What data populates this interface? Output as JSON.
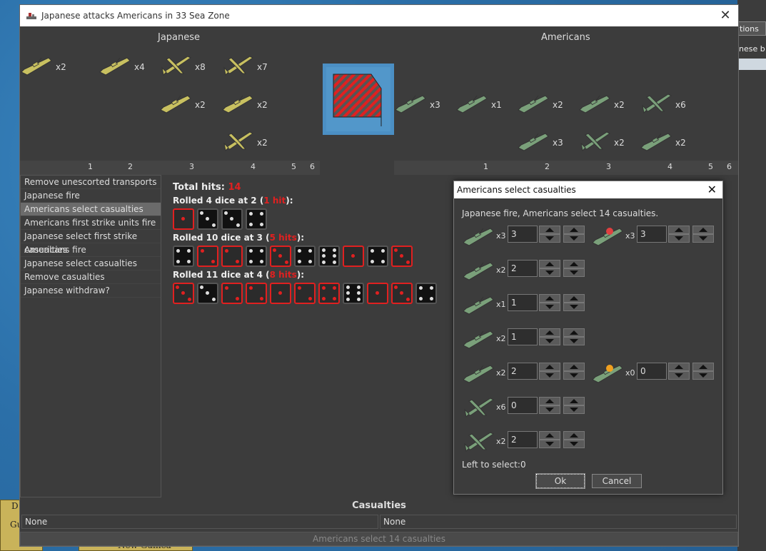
{
  "window": {
    "title": "Japanese attacks Americans in 33 Sea Zone",
    "left_side": "Japanese",
    "right_side": "Americans"
  },
  "background": {
    "tab_label": "tions",
    "text": "nese b",
    "map_label_1": "D",
    "map_label_2": "Gu",
    "map_label_3": "New Guinea"
  },
  "attackers": [
    {
      "count": "x2"
    },
    {
      "count": "x4"
    },
    {
      "count": "x8"
    },
    {
      "count": "x7"
    },
    {
      "count": "x2"
    },
    {
      "count": "x2"
    },
    {
      "count": "x2"
    }
  ],
  "defenders": [
    {
      "count": "x3"
    },
    {
      "count": "x1"
    },
    {
      "count": "x2"
    },
    {
      "count": "x2"
    },
    {
      "count": "x6"
    },
    {
      "count": "x3"
    },
    {
      "count": "x2"
    },
    {
      "count": "x2"
    }
  ],
  "left_ruler": [
    "1",
    "2",
    "3",
    "4",
    "5",
    "6"
  ],
  "right_ruler": [
    "1",
    "2",
    "3",
    "4",
    "5",
    "6"
  ],
  "steps": [
    "Remove unescorted transports",
    "Japanese fire",
    "Americans select casualties",
    "Americans first strike units fire",
    "Japanese select first strike casualties",
    "Americans fire",
    "Japanese select casualties",
    "Remove casualties",
    "Japanese withdraw?"
  ],
  "selected_step": 2,
  "dice": {
    "total_label": "Total hits:",
    "total_value": "14",
    "rolls": [
      {
        "prefix": "Rolled 4 dice at 2 (",
        "hits": "1 hit",
        "suffix": "):",
        "dice": [
          {
            "v": 1,
            "hit": true
          },
          {
            "v": 3,
            "hit": false
          },
          {
            "v": 3,
            "hit": false
          },
          {
            "v": 4,
            "hit": false
          }
        ]
      },
      {
        "prefix": "Rolled 10 dice at 3 (",
        "hits": "5 hits",
        "suffix": "):",
        "dice": [
          {
            "v": 4,
            "hit": false
          },
          {
            "v": 2,
            "hit": true
          },
          {
            "v": 2,
            "hit": true
          },
          {
            "v": 4,
            "hit": false
          },
          {
            "v": 3,
            "hit": true
          },
          {
            "v": 4,
            "hit": false
          },
          {
            "v": 6,
            "hit": false
          },
          {
            "v": 1,
            "hit": true
          },
          {
            "v": 4,
            "hit": false
          },
          {
            "v": 3,
            "hit": true
          }
        ]
      },
      {
        "prefix": "Rolled 11 dice at 4 (",
        "hits": "8 hits",
        "suffix": "):",
        "dice": [
          {
            "v": 3,
            "hit": true
          },
          {
            "v": 3,
            "hit": false
          },
          {
            "v": 2,
            "hit": true
          },
          {
            "v": 2,
            "hit": true
          },
          {
            "v": 1,
            "hit": true
          },
          {
            "v": 2,
            "hit": true
          },
          {
            "v": 4,
            "hit": true
          },
          {
            "v": 6,
            "hit": false
          },
          {
            "v": 1,
            "hit": true
          },
          {
            "v": 3,
            "hit": true
          },
          {
            "v": 4,
            "hit": false
          }
        ]
      }
    ]
  },
  "casualties": {
    "title": "Casualties",
    "left": "None",
    "right": "None"
  },
  "status": "Americans select 14 casualties",
  "popup": {
    "title": "Americans select casualties",
    "message": "Japanese fire,  Americans select 14 casualties.",
    "rows": [
      [
        {
          "count": "x3",
          "value": "3"
        },
        {
          "count": "x3",
          "value": "3"
        }
      ],
      [
        {
          "count": "x2",
          "value": "2"
        }
      ],
      [
        {
          "count": "x1",
          "value": "1"
        }
      ],
      [
        {
          "count": "x2",
          "value": "1"
        }
      ],
      [
        {
          "count": "x2",
          "value": "2"
        },
        {
          "count": "x0",
          "value": "0"
        }
      ],
      [
        {
          "count": "x6",
          "value": "0"
        }
      ],
      [
        {
          "count": "x2",
          "value": "2"
        }
      ]
    ],
    "left_to_select": "Left to select:0",
    "ok": "Ok",
    "cancel": "Cancel"
  },
  "colors": {
    "japanese_unit": "#c8c060",
    "american_unit": "#7aa07a",
    "hit_red": "#e02020"
  }
}
